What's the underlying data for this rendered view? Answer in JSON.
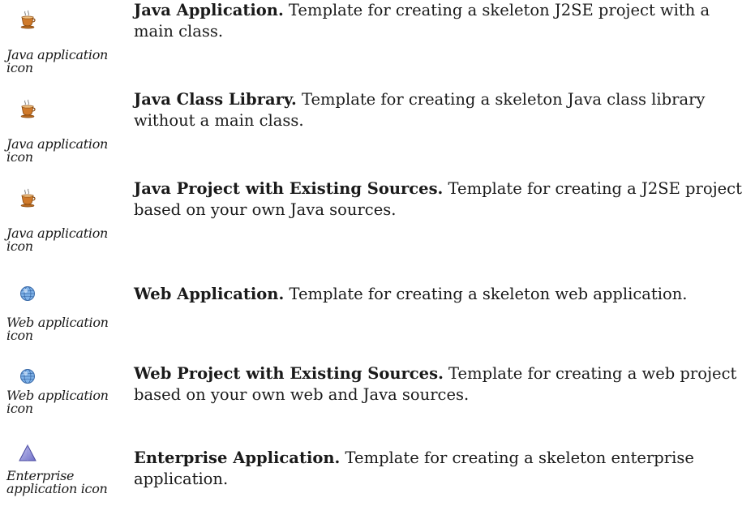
{
  "templates": [
    {
      "icon": "java-cup-icon",
      "icon_caption": "Java application icon",
      "title": "Java Application.",
      "description": " Template for creating a skeleton J2SE project with a main class."
    },
    {
      "icon": "java-cup-icon",
      "icon_caption": "Java application icon",
      "title": "Java Class Library.",
      "description": " Template for creating a skeleton Java class library without a main class."
    },
    {
      "icon": "java-cup-icon",
      "icon_caption": "Java application icon",
      "title": "Java Project with Existing Sources.",
      "description": " Template for creating a J2SE project based on your own Java sources."
    },
    {
      "icon": "globe-icon",
      "icon_caption": "Web application icon",
      "title": "Web Application.",
      "description": " Template for creating a skeleton web application."
    },
    {
      "icon": "globe-icon",
      "icon_caption": "Web application icon",
      "title": "Web Project with Existing Sources.",
      "description": " Template for creating a web project based on your own web and Java sources."
    },
    {
      "icon": "triangle-icon",
      "icon_caption": "Enterprise application icon",
      "title": "Enterprise Application.",
      "description": " Template for creating a skeleton enterprise application."
    }
  ]
}
